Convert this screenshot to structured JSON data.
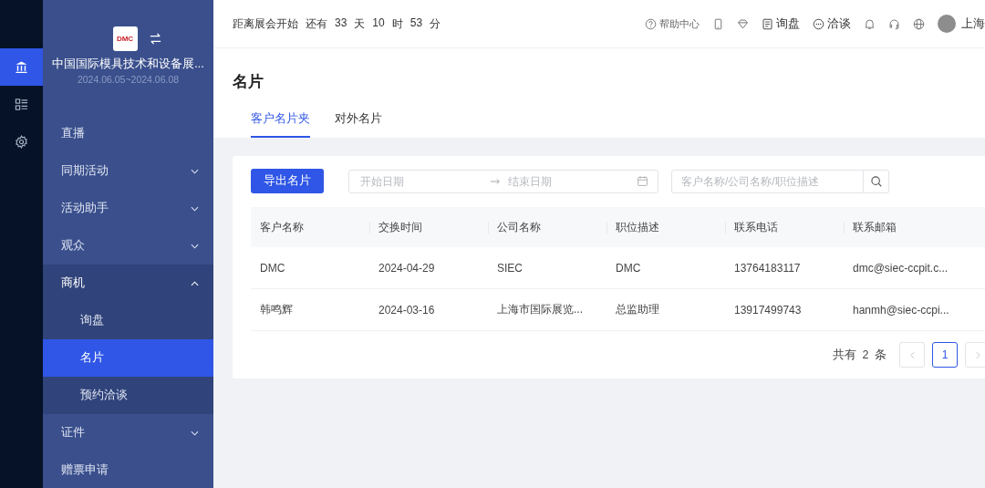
{
  "rail": {
    "items": [
      {
        "kind": "bank",
        "selected": true
      },
      {
        "kind": "list",
        "selected": false
      },
      {
        "kind": "gear",
        "selected": false
      }
    ]
  },
  "sidebar": {
    "logo": "DMC",
    "event_title": "中国国际模具技术和设备展...",
    "event_dates": "2024.06.05~2024.06.08",
    "items": [
      {
        "label": "直播",
        "expandable": false,
        "expanded": false,
        "selected": false
      },
      {
        "label": "同期活动",
        "expandable": true,
        "expanded": false,
        "selected": false
      },
      {
        "label": "活动助手",
        "expandable": true,
        "expanded": false,
        "selected": false
      },
      {
        "label": "观众",
        "expandable": true,
        "expanded": false,
        "selected": false
      },
      {
        "label": "商机",
        "expandable": true,
        "expanded": true,
        "selected": false,
        "children": [
          {
            "label": "询盘",
            "selected": false
          },
          {
            "label": "名片",
            "selected": true
          },
          {
            "label": "预约洽谈",
            "selected": false
          }
        ]
      },
      {
        "label": "证件",
        "expandable": true,
        "expanded": false,
        "selected": false
      },
      {
        "label": "赠票申请",
        "expandable": false,
        "expanded": false,
        "selected": false
      }
    ]
  },
  "header": {
    "countdown": [
      "距离展会开始",
      "还有",
      "33",
      "天",
      "10",
      "时",
      "53",
      "分"
    ],
    "actions": [
      {
        "kind": "help",
        "label": "帮助中心"
      },
      {
        "kind": "phone"
      },
      {
        "kind": "diamond"
      },
      {
        "kind": "inquiry",
        "label": "询盘"
      },
      {
        "kind": "chat",
        "label": "洽谈"
      },
      {
        "kind": "bell"
      },
      {
        "kind": "headset"
      },
      {
        "kind": "globe"
      }
    ],
    "user": "上海"
  },
  "page": {
    "title": "名片",
    "tabs": [
      {
        "label": "客户名片夹",
        "selected": true
      },
      {
        "label": "对外名片",
        "selected": false
      }
    ]
  },
  "toolbar": {
    "export_button": "导出名片",
    "start_placeholder": "开始日期",
    "end_placeholder": "结束日期",
    "search_placeholder": "客户名称/公司名称/职位描述"
  },
  "table": {
    "columns": [
      "客户名称",
      "交换时间",
      "公司名称",
      "职位描述",
      "联系电话",
      "联系邮箱"
    ],
    "rows": [
      [
        "DMC",
        "2024-04-29",
        "SIEC",
        "DMC",
        "13764183117",
        "dmc@siec-ccpit.c..."
      ],
      [
        "韩鸣辉",
        "2024-03-16",
        "上海市国际展览...",
        "总监助理",
        "13917499743",
        "hanmh@siec-ccpi..."
      ]
    ]
  },
  "pagination": {
    "total": "共有 2 条",
    "pages": [
      {
        "label": "1",
        "selected": true
      }
    ]
  }
}
